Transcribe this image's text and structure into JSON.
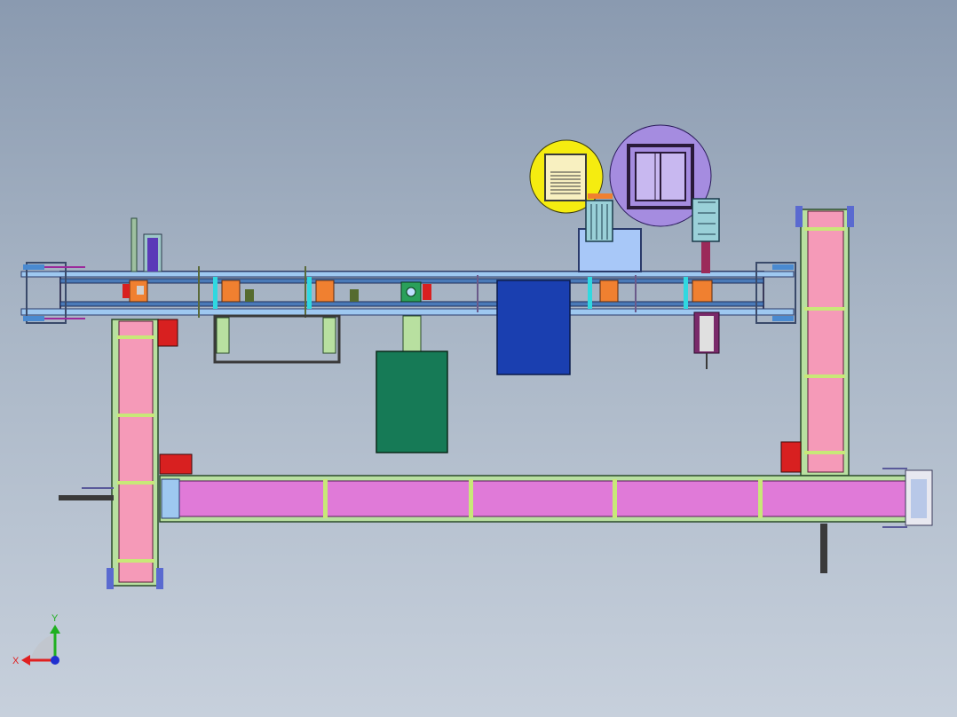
{
  "view": {
    "background_top": "#8a9ab0",
    "background_bottom": "#c7d0dc"
  },
  "triad": {
    "x_label": "X",
    "y_label": "Y",
    "x_color": "#e02020",
    "y_color": "#20b020",
    "z_color": "#2030d0"
  },
  "colors": {
    "belt_pink": "#f59ab8",
    "belt_magenta": "#e07ad8",
    "frame_green": "#b8e0a0",
    "rail_blue": "#4a7ab8",
    "rail_light": "#9ec8f0",
    "motor_red": "#d82020",
    "blue_panel": "#1a3fb0",
    "green_box": "#167a56",
    "yellow_zone": "#f5ec10",
    "purple_zone": "#a58ce0",
    "cyan_part": "#30d8e0",
    "orange_part": "#f08030"
  }
}
